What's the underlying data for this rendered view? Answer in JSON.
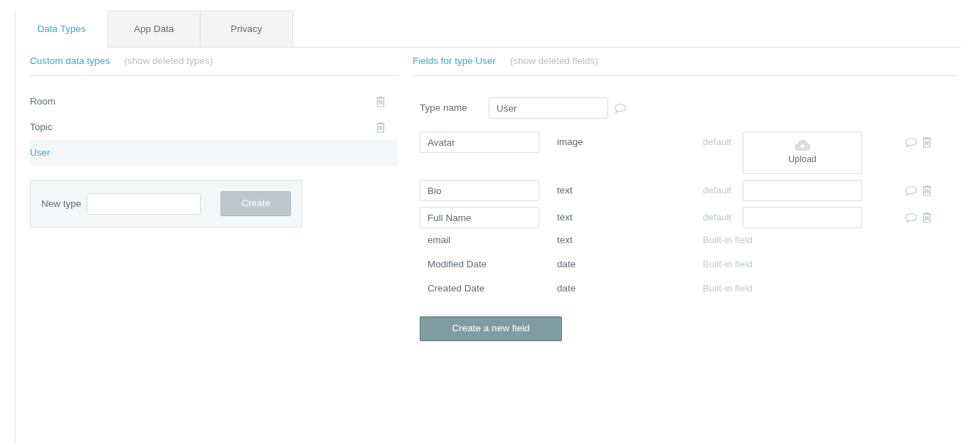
{
  "tabs": [
    {
      "label": "Data Types",
      "selected": true
    },
    {
      "label": "App Data",
      "selected": false
    },
    {
      "label": "Privacy",
      "selected": false
    }
  ],
  "types_panel": {
    "title": "Custom data types",
    "toggle": "(show deleted types)",
    "items": [
      {
        "label": "Room",
        "selected": false,
        "deletable": true
      },
      {
        "label": "Topic",
        "selected": false,
        "deletable": true
      },
      {
        "label": "User",
        "selected": true,
        "deletable": false
      }
    ],
    "new_type": {
      "label": "New type",
      "button": "Create",
      "button_disabled": true
    }
  },
  "fields_panel": {
    "title": "Fields for type User",
    "toggle": "(show deleted fields)",
    "type_name": {
      "label": "Type name",
      "value": "User"
    },
    "fields": [
      {
        "kind": "upload",
        "name": "Avatar",
        "type": "image",
        "default_label": "default",
        "upload_label": "Upload"
      },
      {
        "kind": "text",
        "name": "Bio",
        "type": "text",
        "default_label": "default"
      },
      {
        "kind": "text",
        "name": "Full Name",
        "type": "text",
        "default_label": "default"
      },
      {
        "kind": "builtin",
        "name": "email",
        "type": "text",
        "note": "Built-in field"
      },
      {
        "kind": "builtin",
        "name": "Modified Date",
        "type": "date",
        "note": "Built-in field"
      },
      {
        "kind": "builtin",
        "name": "Created Date",
        "type": "date",
        "note": "Built-in field"
      }
    ],
    "create_button": "Create a new field"
  }
}
